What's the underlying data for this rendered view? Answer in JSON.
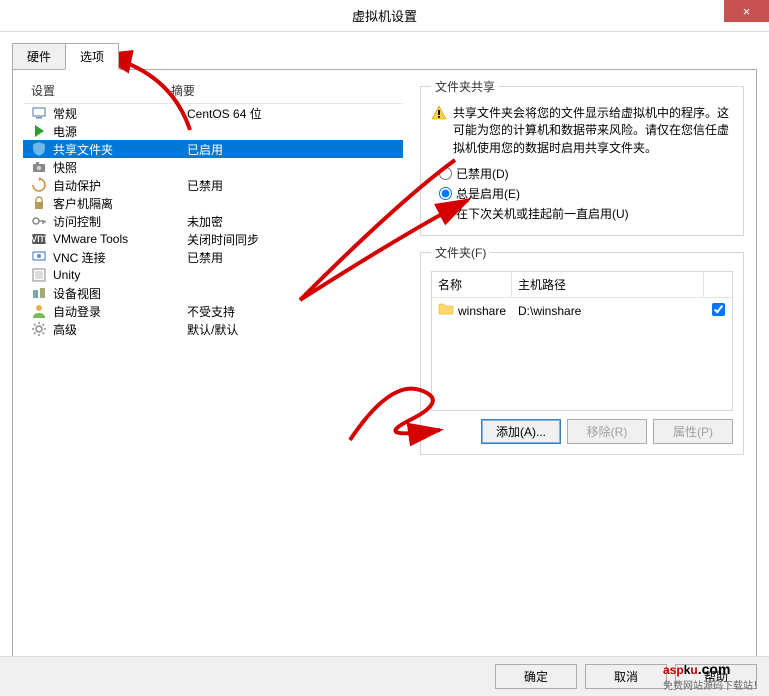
{
  "window": {
    "title": "虚拟机设置",
    "close": "×"
  },
  "tabs": {
    "hardware": "硬件",
    "options": "选项"
  },
  "left_list": {
    "headers": {
      "setting": "设置",
      "summary": "摘要"
    },
    "rows": [
      {
        "icon": "monitor",
        "label": "常规",
        "summary": "CentOS 64 位"
      },
      {
        "icon": "play",
        "label": "电源",
        "summary": ""
      },
      {
        "icon": "shield",
        "label": "共享文件夹",
        "summary": "已启用",
        "selected": true
      },
      {
        "icon": "camera",
        "label": "快照",
        "summary": ""
      },
      {
        "icon": "refresh",
        "label": "自动保护",
        "summary": "已禁用"
      },
      {
        "icon": "lock",
        "label": "客户机隔离",
        "summary": ""
      },
      {
        "icon": "key",
        "label": "访问控制",
        "summary": "未加密"
      },
      {
        "icon": "vm",
        "label": "VMware Tools",
        "summary": "关闭时间同步"
      },
      {
        "icon": "vnc",
        "label": "VNC 连接",
        "summary": "已禁用"
      },
      {
        "icon": "unity",
        "label": "Unity",
        "summary": ""
      },
      {
        "icon": "device",
        "label": "设备视图",
        "summary": ""
      },
      {
        "icon": "user",
        "label": "自动登录",
        "summary": "不受支持"
      },
      {
        "icon": "gear",
        "label": "高级",
        "summary": "默认/默认"
      }
    ]
  },
  "sharing": {
    "legend": "文件夹共享",
    "warning": "共享文件夹会将您的文件显示给虚拟机中的程序。这可能为您的计算机和数据带来风险。请仅在您信任虚拟机使用您的数据时启用共享文件夹。",
    "radios": {
      "disabled": "已禁用(D)",
      "always": "总是启用(E)",
      "until": "在下次关机或挂起前一直启用(U)"
    }
  },
  "folders": {
    "legend": "文件夹(F)",
    "headers": {
      "name": "名称",
      "path": "主机路径"
    },
    "rows": [
      {
        "name": "winshare",
        "path": "D:\\winshare",
        "checked": true
      }
    ],
    "buttons": {
      "add": "添加(A)...",
      "remove": "移除(R)",
      "props": "属性(P)"
    }
  },
  "footer": {
    "ok": "确定",
    "cancel": "取消",
    "help": "帮助"
  },
  "watermark": {
    "main_pre": "asp",
    "main_k": "k",
    "main_u": "u",
    "dot": ".com",
    "sub": "免费网站源码下载站！"
  }
}
